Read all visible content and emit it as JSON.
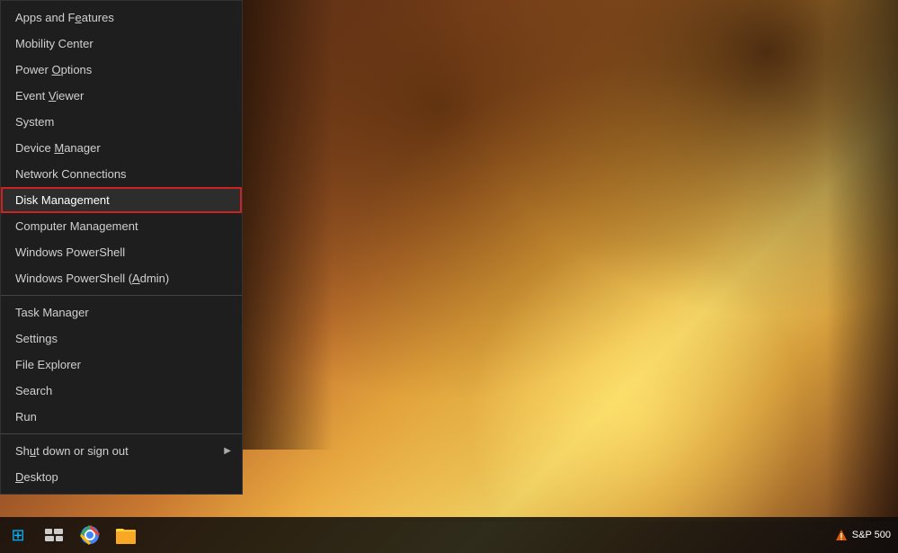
{
  "desktop": {
    "background_desc": "Autumn forest path with warm golden light"
  },
  "context_menu": {
    "items": [
      {
        "id": "apps-features",
        "label": "Apps and Features",
        "underline_index": 9,
        "separator_after": false
      },
      {
        "id": "mobility-center",
        "label": "Mobility Center",
        "underline_index": 8,
        "separator_after": false
      },
      {
        "id": "power-options",
        "label": "Power Options",
        "underline_index": 6,
        "separator_after": false
      },
      {
        "id": "event-viewer",
        "label": "Event Viewer",
        "underline_index": 6,
        "separator_after": false
      },
      {
        "id": "system",
        "label": "System",
        "underline_index": -1,
        "separator_after": false
      },
      {
        "id": "device-manager",
        "label": "Device Manager",
        "underline_index": 7,
        "separator_after": false
      },
      {
        "id": "network-connections",
        "label": "Network Connections",
        "underline_index": -1,
        "separator_after": false
      },
      {
        "id": "disk-management",
        "label": "Disk Management",
        "underline_index": -1,
        "active": true,
        "separator_after": false
      },
      {
        "id": "computer-management",
        "label": "Computer Management",
        "underline_index": -1,
        "separator_after": false
      },
      {
        "id": "windows-powershell",
        "label": "Windows PowerShell",
        "underline_index": -1,
        "separator_after": false
      },
      {
        "id": "windows-powershell-admin",
        "label": "Windows PowerShell (Admin)",
        "underline_index": -1,
        "separator_after": true
      },
      {
        "id": "task-manager",
        "label": "Task Manager",
        "underline_index": -1,
        "separator_after": false
      },
      {
        "id": "settings",
        "label": "Settings",
        "underline_index": -1,
        "separator_after": false
      },
      {
        "id": "file-explorer",
        "label": "File Explorer",
        "underline_index": -1,
        "separator_after": false
      },
      {
        "id": "search",
        "label": "Search",
        "underline_index": -1,
        "separator_after": false
      },
      {
        "id": "run",
        "label": "Run",
        "underline_index": -1,
        "separator_after": true
      },
      {
        "id": "shut-down-sign-out",
        "label": "Shut down or sign out",
        "underline_index": -1,
        "has_arrow": true,
        "separator_after": false
      },
      {
        "id": "desktop",
        "label": "Desktop",
        "underline_index": -1,
        "separator_after": false
      }
    ]
  },
  "taskbar": {
    "icons": [
      {
        "id": "windows-start",
        "label": "Start",
        "icon": "⊞"
      },
      {
        "id": "task-view",
        "label": "Task View",
        "icon": "❑"
      },
      {
        "id": "chrome",
        "label": "Google Chrome",
        "icon": "●"
      },
      {
        "id": "file-explorer",
        "label": "File Explorer",
        "icon": "📁"
      }
    ],
    "system_tray": {
      "stock_icon": "📈",
      "stock_label": "S&P 500"
    }
  }
}
